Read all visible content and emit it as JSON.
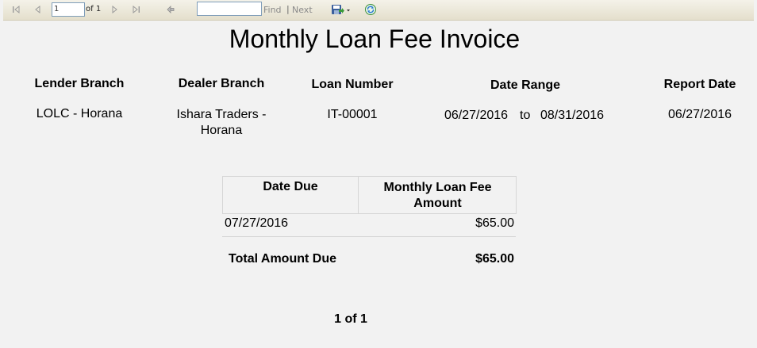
{
  "toolbar": {
    "current_page": "1",
    "of_label": "of 1",
    "find_placeholder": "",
    "find_label": "Find",
    "separator": "|",
    "next_label": "Next"
  },
  "report": {
    "title": "Monthly Loan Fee Invoice",
    "headers": {
      "lender_branch": "Lender Branch",
      "dealer_branch": "Dealer Branch",
      "loan_number": "Loan Number",
      "date_range": "Date Range",
      "report_date": "Report Date"
    },
    "values": {
      "lender_branch": "LOLC - Horana",
      "dealer_branch_line1": "Ishara Traders -",
      "dealer_branch_line2": "Horana",
      "loan_number": "IT-00001",
      "date_from": "06/27/2016",
      "date_to_word": "to",
      "date_to": "08/31/2016",
      "report_date": "06/27/2016"
    },
    "table": {
      "col_date": "Date Due",
      "col_amount_line1": "Monthly Loan Fee",
      "col_amount_line2": "Amount",
      "rows": [
        {
          "date": "07/27/2016",
          "amount": "$65.00"
        }
      ],
      "total_label": "Total Amount Due",
      "total_amount": "$65.00"
    },
    "page_count": "1 of 1"
  }
}
